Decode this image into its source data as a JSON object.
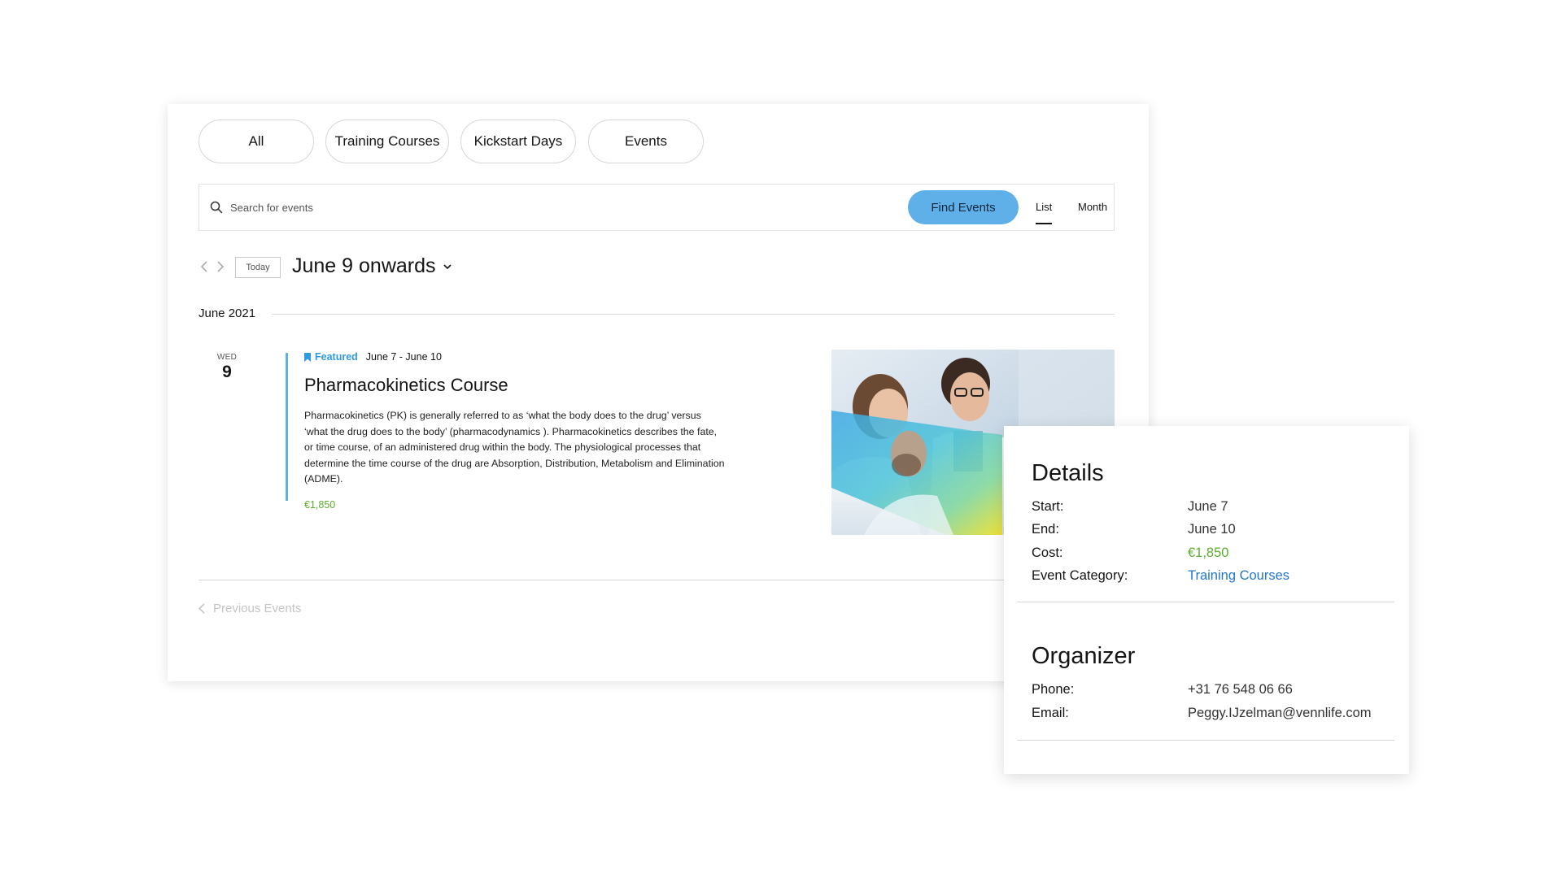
{
  "filters": {
    "all": "All",
    "training_courses": "Training Courses",
    "kickstart_days": "Kickstart Days",
    "events": "Events"
  },
  "search": {
    "placeholder": "Search for events",
    "find_button": "Find Events"
  },
  "view_tabs": {
    "list": "List",
    "month": "Month",
    "active": "List"
  },
  "navigation": {
    "today_button": "Today",
    "date_range": "June 9 onwards"
  },
  "month_header": "June 2021",
  "event": {
    "weekday": "WED",
    "day": "9",
    "featured_label": "Featured",
    "date_range": "June 7 - June 10",
    "title": "Pharmacokinetics Course",
    "description": "Pharmacokinetics (PK) is generally referred to as ‘what the body does to the drug’ versus ‘what the drug does to the body’ (pharmacodynamics ). Pharmacokinetics describes the fate, or time course, of an administered drug within the body. The physiological processes that determine the time course of the drug are Absorption, Distribution, Metabolism and Elimination (ADME).",
    "cost": "€1,850"
  },
  "pagination": {
    "previous": "Previous Events"
  },
  "details": {
    "heading": "Details",
    "start_label": "Start:",
    "start_value": "June 7",
    "end_label": "End:",
    "end_value": "June 10",
    "cost_label": "Cost:",
    "cost_value": "€1,850",
    "category_label": "Event Category:",
    "category_value": "Training Courses"
  },
  "organizer": {
    "heading": "Organizer",
    "phone_label": "Phone:",
    "phone_value": "+31 76 548 06 66",
    "email_label": "Email:",
    "email_value": "Peggy.IJzelman@vennlife.com"
  },
  "colors": {
    "accent_blue": "#5fb0e8",
    "featured_blue": "#2e9be0",
    "price_green": "#5cae2e",
    "link_blue": "#2277cc"
  },
  "icons": {
    "search": "search-icon",
    "featured": "bookmark-icon",
    "prev": "chevron-left-icon",
    "next": "chevron-right-icon",
    "dropdown": "chevron-down-icon"
  }
}
